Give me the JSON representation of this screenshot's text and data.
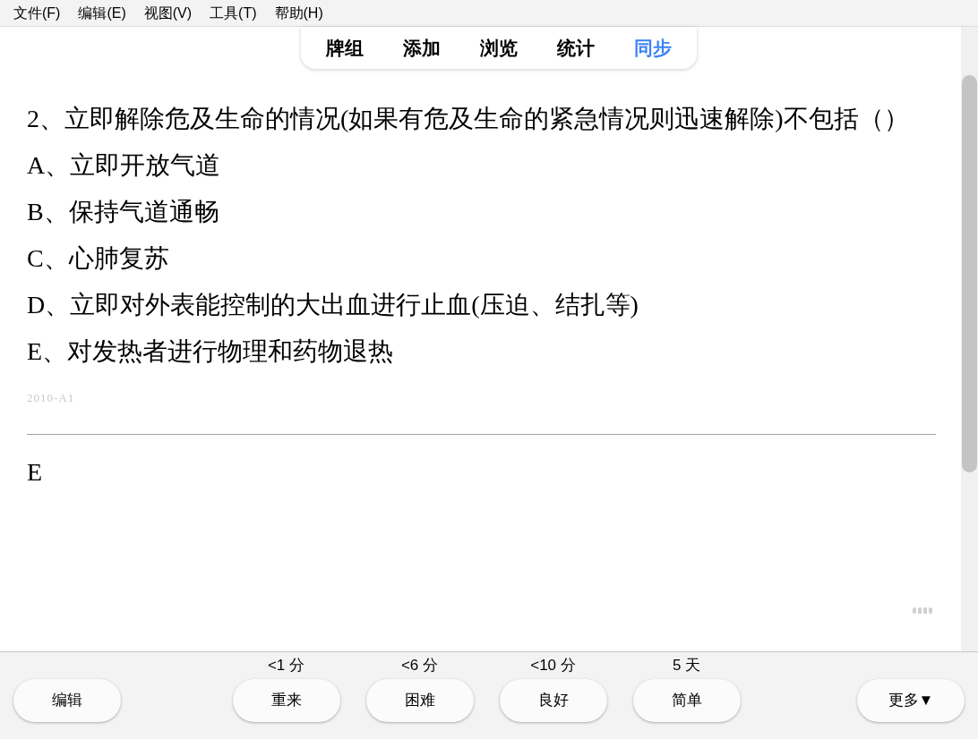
{
  "menu_bar": [
    "文件(F)",
    "编辑(E)",
    "视图(V)",
    "工具(T)",
    "帮助(H)"
  ],
  "toolbar": [
    {
      "label": "牌组",
      "highlighted": false
    },
    {
      "label": "添加",
      "highlighted": false
    },
    {
      "label": "浏览",
      "highlighted": false
    },
    {
      "label": "统计",
      "highlighted": false
    },
    {
      "label": "同步",
      "highlighted": true
    }
  ],
  "card": {
    "question": "2、立即解除危及生命的情况(如果有危及生命的紧急情况则迅速解除)不包括（）",
    "options": [
      "A、立即开放气道",
      "B、保持气道通畅",
      "C、心肺复苏",
      "D、立即对外表能控制的大出血进行止血(压迫、结扎等)",
      "E、对发热者进行物理和药物退热"
    ],
    "tags": "2010-A1",
    "answer": "E"
  },
  "bottom_bar": {
    "edit_button": "编辑",
    "answers": [
      {
        "interval": "<1 分",
        "label": "重来"
      },
      {
        "interval": "<6 分",
        "label": "困难"
      },
      {
        "interval": "<10 分",
        "label": "良好"
      },
      {
        "interval": "5 天",
        "label": "简单"
      }
    ],
    "more_button": "更多▼"
  }
}
